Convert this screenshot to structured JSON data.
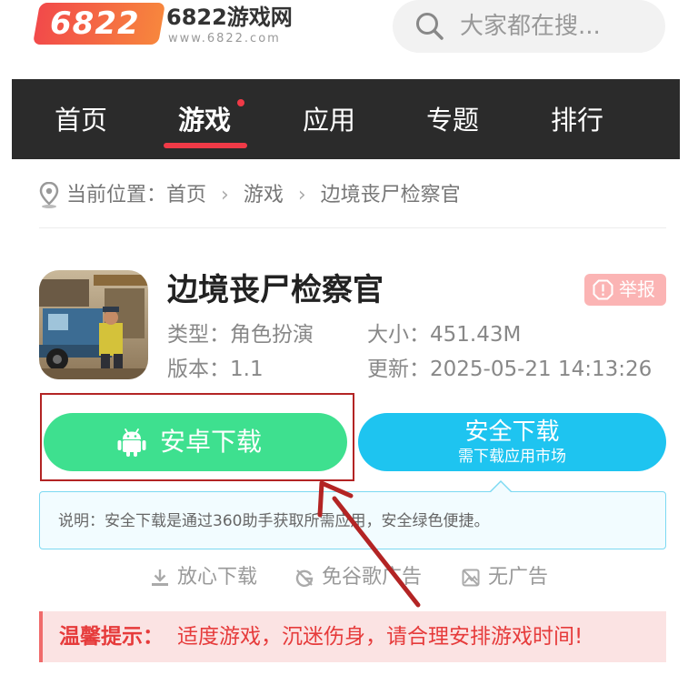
{
  "header": {
    "logo_badge": "6822",
    "logo_title": "6822游戏网",
    "logo_url": "www.6822.com",
    "search_placeholder": "大家都在搜..."
  },
  "nav": {
    "items": [
      {
        "label": "首页"
      },
      {
        "label": "游戏"
      },
      {
        "label": "应用"
      },
      {
        "label": "专题"
      },
      {
        "label": "排行"
      }
    ],
    "active": "游戏"
  },
  "breadcrumb": {
    "prefix": "当前位置：",
    "items": [
      "首页",
      "游戏",
      "边境丧尸检察官"
    ]
  },
  "app": {
    "name": "边境丧尸检察官",
    "report_label": "举报",
    "type_label": "类型：",
    "type_value": "角色扮演",
    "size_label": "大小：",
    "size_value": "451.43M",
    "version_label": "版本：",
    "version_value": "1.1",
    "updated_label": "更新：",
    "updated_value": "2025-05-21 14:13:26"
  },
  "download": {
    "android_label": "安卓下载",
    "safe_title": "安全下载",
    "safe_subtitle": "需下载应用市场"
  },
  "note": {
    "text": "说明：安全下载是通过360助手获取所需应用，安全绿色便捷。"
  },
  "features": [
    "放心下载",
    "免谷歌广告",
    "无广告"
  ],
  "tip": {
    "label": "温馨提示：",
    "text": "适度游戏，沉迷伤身，请合理安排游戏时间!"
  },
  "colors": {
    "nav_bg": "#2b2b2b",
    "accent_red": "#f03a47",
    "android_green": "#3ee08f",
    "safe_blue": "#1ec4f0",
    "tip_red": "#e63b3b",
    "annotation_red": "#b32424"
  }
}
